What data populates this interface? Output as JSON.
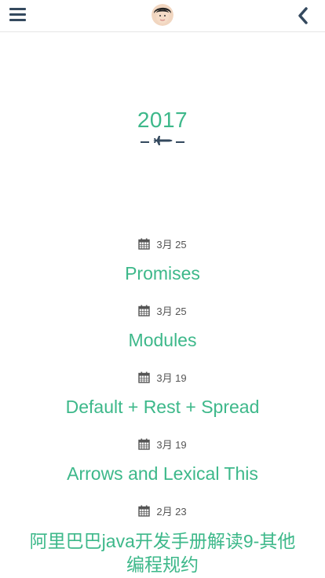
{
  "header": {
    "menu_icon": "hamburger-menu-icon",
    "avatar_icon": "user-avatar",
    "back_icon": "chevron-left-icon"
  },
  "archive": {
    "year": "2017",
    "divider_icon": "airplane-icon"
  },
  "posts": [
    {
      "date": "3月 25",
      "title": "Promises"
    },
    {
      "date": "3月 25",
      "title": "Modules"
    },
    {
      "date": "3月 19",
      "title": "Default + Rest + Spread"
    },
    {
      "date": "3月 19",
      "title": "Arrows and Lexical This"
    },
    {
      "date": "2月 23",
      "title": "阿里巴巴java开发手册解读9-其他编程规约"
    }
  ],
  "colors": {
    "accent": "#3db88a",
    "icon": "#34495e",
    "date_text": "#555555"
  }
}
